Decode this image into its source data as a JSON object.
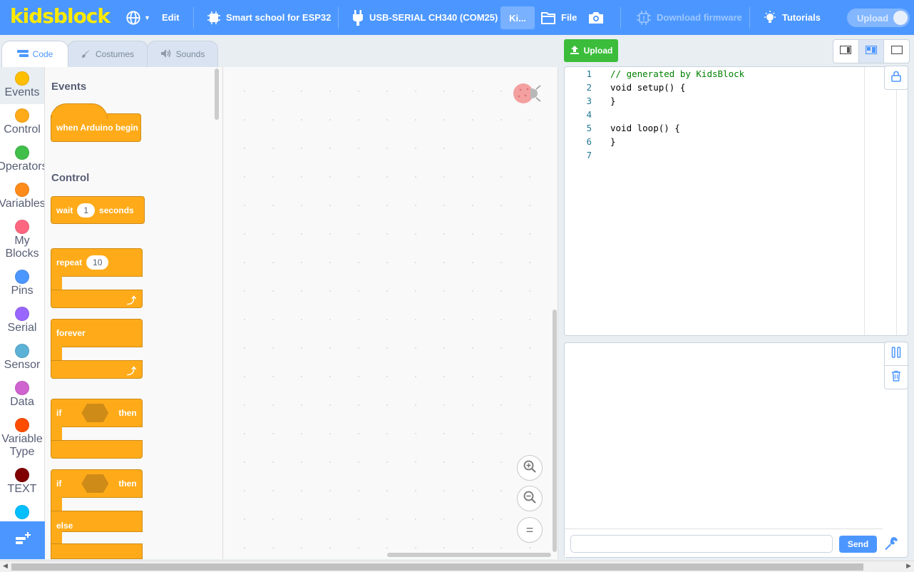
{
  "menubar": {
    "logo": "kidsblock",
    "edit": "Edit",
    "device": "Smart school for ESP32",
    "port": "USB-SERIAL CH340 (COM25)",
    "project": "Ki...",
    "file": "File",
    "download_firmware": "Download firmware",
    "tutorials": "Tutorials",
    "upload_toggle": "Upload"
  },
  "tabs": {
    "code": "Code",
    "costumes": "Costumes",
    "sounds": "Sounds"
  },
  "categories": [
    {
      "label": "Events",
      "color": "#ffbf00"
    },
    {
      "label": "Control",
      "color": "#ffab19"
    },
    {
      "label": "Operators",
      "color": "#40bf4a"
    },
    {
      "label": "Variables",
      "color": "#ff8c1a"
    },
    {
      "label": "My Blocks",
      "color": "#ff6680"
    },
    {
      "label": "Pins",
      "color": "#4c97ff"
    },
    {
      "label": "Serial",
      "color": "#9966ff"
    },
    {
      "label": "Sensor",
      "color": "#5cb1d6"
    },
    {
      "label": "Data",
      "color": "#cf63cf"
    },
    {
      "label": "Variable Type",
      "color": "#ff4d00"
    },
    {
      "label": "TEXT",
      "color": "#800000"
    },
    {
      "label": "",
      "color": "#00bfff"
    }
  ],
  "flyout": {
    "events_title": "Events",
    "when_arduino_begin": "when Arduino begin",
    "control_title": "Control",
    "wait": "wait",
    "wait_value": "1",
    "seconds": "seconds",
    "repeat": "repeat",
    "repeat_value": "10",
    "forever": "forever",
    "if": "if",
    "then": "then",
    "else": "else"
  },
  "workspace": {
    "zoom_in": "+",
    "zoom_out": "−",
    "zoom_reset": "="
  },
  "right": {
    "upload": "Upload",
    "code_lines": [
      {
        "n": "1",
        "text": "// generated by KidsBlock"
      },
      {
        "n": "2",
        "text": "void setup() {"
      },
      {
        "n": "3",
        "text": "}"
      },
      {
        "n": "4",
        "text": ""
      },
      {
        "n": "5",
        "text": "void loop() {"
      },
      {
        "n": "6",
        "text": "}"
      },
      {
        "n": "7",
        "text": ""
      }
    ],
    "send": "Send"
  }
}
